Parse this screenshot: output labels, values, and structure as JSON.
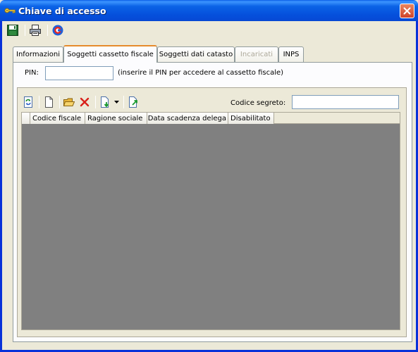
{
  "window": {
    "title": "Chiave di accesso"
  },
  "toolbar": {
    "buttons": [
      {
        "name": "save-icon"
      },
      {
        "name": "print-icon"
      },
      {
        "name": "refresh-circle-icon"
      }
    ]
  },
  "tabs": [
    {
      "label": "Informazioni",
      "active": false,
      "disabled": false
    },
    {
      "label": "Soggetti cassetto fiscale",
      "active": true,
      "disabled": false
    },
    {
      "label": "Soggetti dati catasto",
      "active": false,
      "disabled": false
    },
    {
      "label": "Incaricati",
      "active": false,
      "disabled": true
    },
    {
      "label": "INPS",
      "active": false,
      "disabled": false
    }
  ],
  "pin": {
    "label": "PIN:",
    "value": "",
    "hint": "(inserire il PIN per accedere al cassetto fiscale)"
  },
  "secret": {
    "label": "Codice segreto:",
    "value": ""
  },
  "grid": {
    "columns": [
      "Codice fiscale",
      "Ragione sociale",
      "Data scadenza delega",
      "Disabilitato"
    ],
    "rows": []
  },
  "colors": {
    "titlebar": "#0550DC",
    "window_bg": "#ECE9D8",
    "grid_bg": "#808080",
    "active_tab_accent": "#E68B2C"
  }
}
